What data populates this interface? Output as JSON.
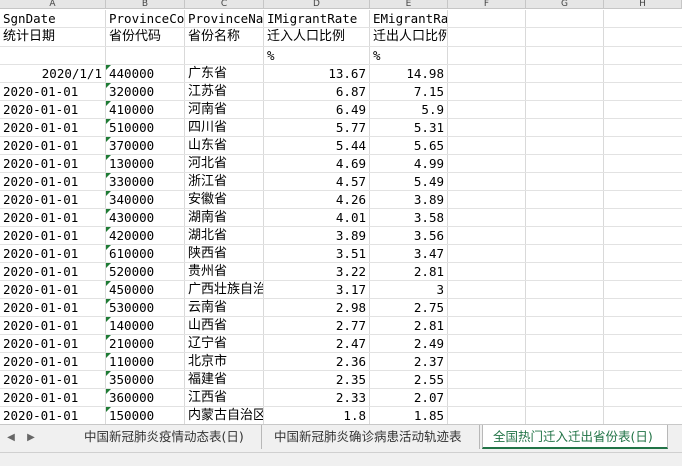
{
  "columns": [
    "A",
    "B",
    "C",
    "D",
    "E",
    "F",
    "G",
    "H"
  ],
  "header_rows": [
    [
      "SgnDate",
      "ProvinceCode",
      "ProvinceName",
      "IMigrantRate",
      "EMigrantRate"
    ],
    [
      "统计日期",
      "省份代码",
      "省份名称",
      "迁入人口比例",
      "迁出人口比例"
    ],
    [
      "",
      "",
      "",
      "%",
      "%"
    ]
  ],
  "rows": [
    [
      "2020/1/1",
      "440000",
      "广东省",
      "13.67",
      "14.98"
    ],
    [
      "2020-01-01",
      "320000",
      "江苏省",
      "6.87",
      "7.15"
    ],
    [
      "2020-01-01",
      "410000",
      "河南省",
      "6.49",
      "5.9"
    ],
    [
      "2020-01-01",
      "510000",
      "四川省",
      "5.77",
      "5.31"
    ],
    [
      "2020-01-01",
      "370000",
      "山东省",
      "5.44",
      "5.65"
    ],
    [
      "2020-01-01",
      "130000",
      "河北省",
      "4.69",
      "4.99"
    ],
    [
      "2020-01-01",
      "330000",
      "浙江省",
      "4.57",
      "5.49"
    ],
    [
      "2020-01-01",
      "340000",
      "安徽省",
      "4.26",
      "3.89"
    ],
    [
      "2020-01-01",
      "430000",
      "湖南省",
      "4.01",
      "3.58"
    ],
    [
      "2020-01-01",
      "420000",
      "湖北省",
      "3.89",
      "3.56"
    ],
    [
      "2020-01-01",
      "610000",
      "陕西省",
      "3.51",
      "3.47"
    ],
    [
      "2020-01-01",
      "520000",
      "贵州省",
      "3.22",
      "2.81"
    ],
    [
      "2020-01-01",
      "450000",
      "广西壮族自治区",
      "3.17",
      "3"
    ],
    [
      "2020-01-01",
      "530000",
      "云南省",
      "2.98",
      "2.75"
    ],
    [
      "2020-01-01",
      "140000",
      "山西省",
      "2.77",
      "2.81"
    ],
    [
      "2020-01-01",
      "210000",
      "辽宁省",
      "2.47",
      "2.49"
    ],
    [
      "2020-01-01",
      "110000",
      "北京市",
      "2.36",
      "2.37"
    ],
    [
      "2020-01-01",
      "350000",
      "福建省",
      "2.35",
      "2.55"
    ],
    [
      "2020-01-01",
      "360000",
      "江西省",
      "2.33",
      "2.07"
    ],
    [
      "2020-01-01",
      "150000",
      "内蒙古自治区",
      "1.8",
      "1.85"
    ]
  ],
  "sheet_tabs": [
    {
      "label": "中国新冠肺炎疫情动态表(日)",
      "active": false
    },
    {
      "label": "中国新冠肺炎确诊病患活动轨迹表",
      "active": false
    },
    {
      "label": "全国热门迁入迁出省份表(日)",
      "active": true
    }
  ],
  "nav": {
    "prev_icon": "◀",
    "next_icon": "▶"
  },
  "colors": {
    "active_tab": "#217346",
    "error_triangle": "#1e7b34"
  }
}
